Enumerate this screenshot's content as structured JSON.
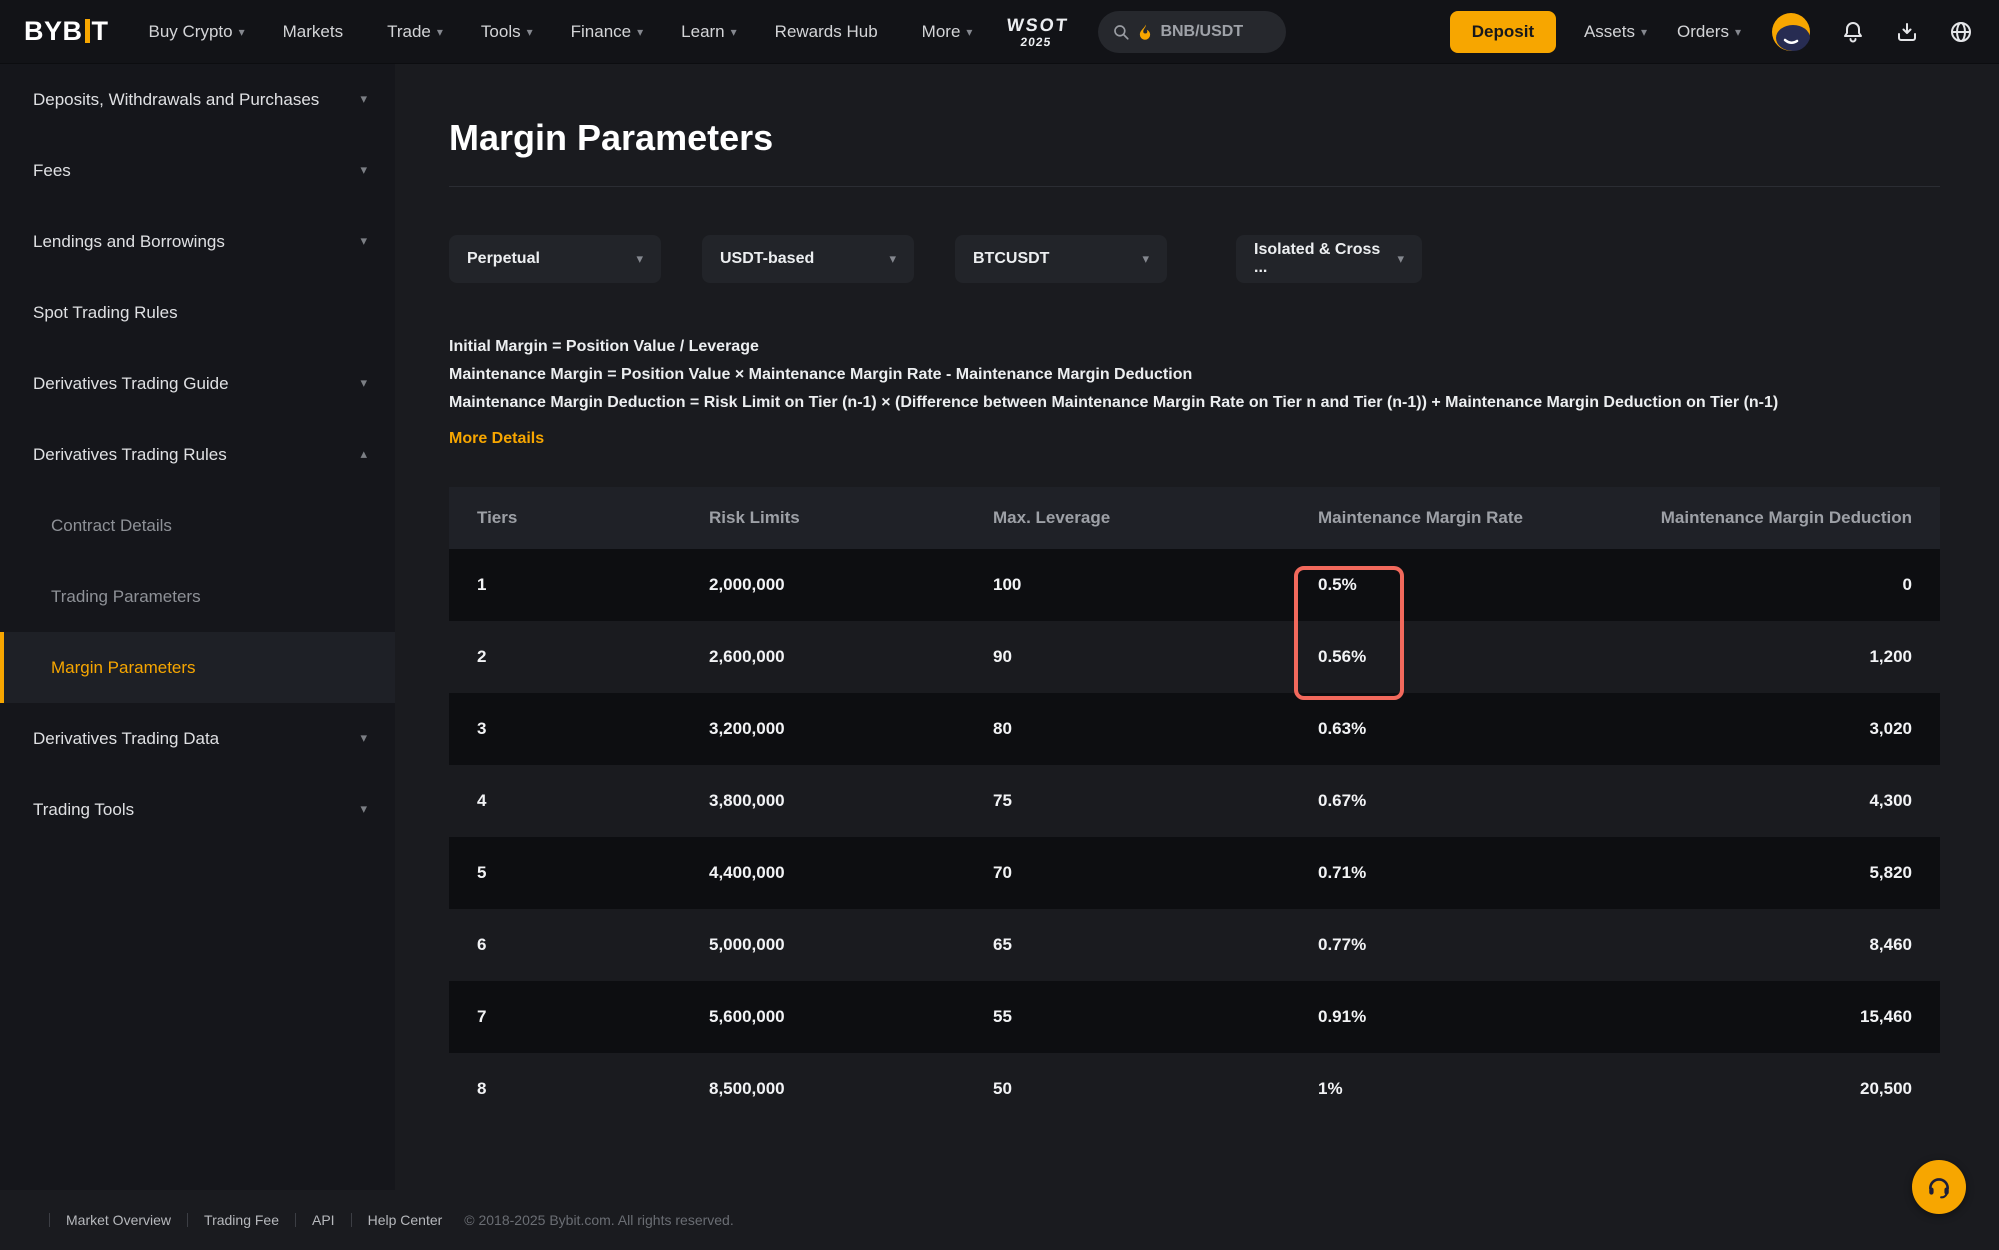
{
  "colors": {
    "accent": "#f7a600",
    "highlight_box": "#f2695c"
  },
  "nav": {
    "logo_left": "BYB",
    "logo_right": "T",
    "items": [
      {
        "label": "Buy Crypto",
        "chev": "▾"
      },
      {
        "label": "Markets",
        "chev": ""
      },
      {
        "label": "Trade",
        "chev": "▾"
      },
      {
        "label": "Tools",
        "chev": "▾"
      },
      {
        "label": "Finance",
        "chev": "▾"
      },
      {
        "label": "Learn",
        "chev": "▾"
      },
      {
        "label": "Rewards Hub",
        "chev": ""
      },
      {
        "label": "More",
        "chev": "▾"
      }
    ],
    "wsot_line1": "WSOT",
    "wsot_line2": "2025",
    "search_value": "BNB/USDT",
    "deposit_label": "Deposit",
    "assets_label": "Assets",
    "orders_label": "Orders",
    "assets_chev": "▾",
    "orders_chev": "▾"
  },
  "sidebar": {
    "items": [
      {
        "label": "Deposits, Withdrawals and Purchases",
        "chev": "▾",
        "sub": false,
        "active": false
      },
      {
        "label": "Fees",
        "chev": "▾",
        "sub": false,
        "active": false
      },
      {
        "label": "Lendings and Borrowings",
        "chev": "▾",
        "sub": false,
        "active": false
      },
      {
        "label": "Spot Trading Rules",
        "chev": "",
        "sub": false,
        "active": false
      },
      {
        "label": "Derivatives Trading Guide",
        "chev": "▾",
        "sub": false,
        "active": false
      },
      {
        "label": "Derivatives Trading Rules",
        "chev": "▴",
        "sub": false,
        "active": false
      },
      {
        "label": "Contract Details",
        "chev": "",
        "sub": true,
        "active": false
      },
      {
        "label": "Trading Parameters",
        "chev": "",
        "sub": true,
        "active": false
      },
      {
        "label": "Margin Parameters",
        "chev": "",
        "sub": true,
        "active": true
      },
      {
        "label": "Derivatives Trading Data",
        "chev": "▾",
        "sub": false,
        "active": false
      },
      {
        "label": "Trading Tools",
        "chev": "▾",
        "sub": false,
        "active": false
      }
    ]
  },
  "main": {
    "title": "Margin Parameters",
    "filters": [
      {
        "value": "Perpetual"
      },
      {
        "value": "USDT-based"
      },
      {
        "value": "BTCUSDT"
      },
      {
        "value": "Isolated & Cross ..."
      }
    ],
    "formulas": [
      "Initial Margin = Position Value / Leverage",
      "Maintenance Margin = Position Value × Maintenance Margin Rate - Maintenance Margin Deduction",
      "Maintenance Margin Deduction = Risk Limit on Tier (n-1) × (Difference between Maintenance Margin Rate on Tier n and Tier (n-1)) + Maintenance Margin Deduction on Tier (n-1)"
    ],
    "more_details_label": "More Details",
    "table": {
      "headers": [
        "Tiers",
        "Risk Limits",
        "Max. Leverage",
        "Maintenance Margin Rate",
        "Maintenance Margin Deduction"
      ],
      "rows": [
        [
          "1",
          "2,000,000",
          "100",
          "0.5%",
          "0"
        ],
        [
          "2",
          "2,600,000",
          "90",
          "0.56%",
          "1,200"
        ],
        [
          "3",
          "3,200,000",
          "80",
          "0.63%",
          "3,020"
        ],
        [
          "4",
          "3,800,000",
          "75",
          "0.67%",
          "4,300"
        ],
        [
          "5",
          "4,400,000",
          "70",
          "0.71%",
          "5,820"
        ],
        [
          "6",
          "5,000,000",
          "65",
          "0.77%",
          "8,460"
        ],
        [
          "7",
          "5,600,000",
          "55",
          "0.91%",
          "15,460"
        ],
        [
          "8",
          "8,500,000",
          "50",
          "1%",
          "20,500"
        ]
      ]
    }
  },
  "footer": {
    "links": [
      "Market Overview",
      "Trading Fee",
      "API",
      "Help Center"
    ],
    "copyright": "© 2018-2025 Bybit.com. All rights reserved."
  }
}
